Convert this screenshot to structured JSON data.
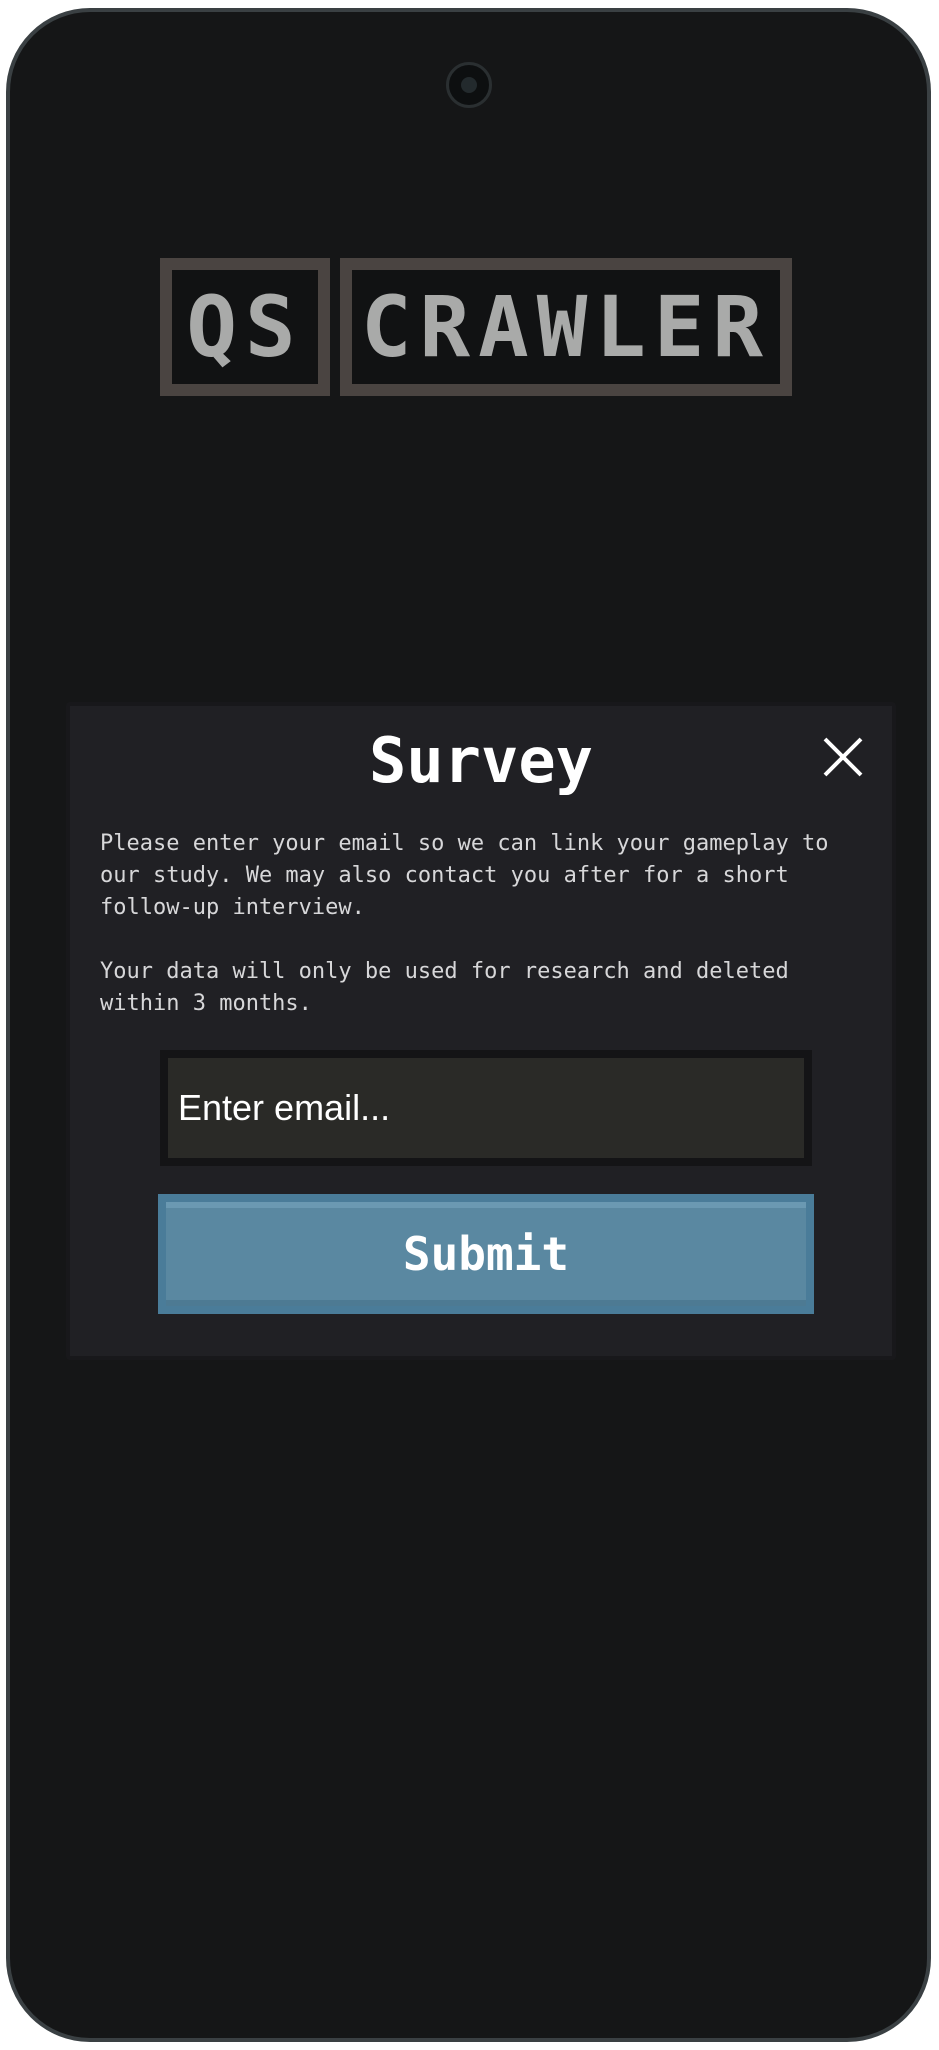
{
  "logo": {
    "part1": "QS",
    "part2": "CRAWLER"
  },
  "survey": {
    "title": "Survey",
    "paragraph1": "Please enter your email so we can link your gameplay to our study. We may also contact you after for a short follow-up interview.",
    "paragraph2": "Your data will only be used for research and deleted within 3 months.",
    "email_value": "",
    "email_placeholder": "Enter email...",
    "submit_label": "Submit",
    "close_icon": "close-icon"
  },
  "colors": {
    "background": "#151617",
    "modal": "#202024",
    "button": "#5a88a1",
    "logo_border": "#4a4441",
    "logo_text": "#a9aaa9"
  }
}
